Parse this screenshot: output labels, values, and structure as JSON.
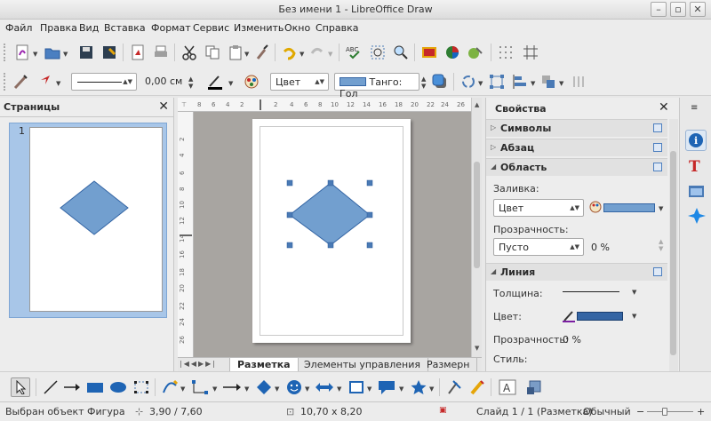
{
  "window": {
    "title": "Без имени 1 - LibreOffice Draw"
  },
  "menu": [
    "Файл",
    "Правка",
    "Вид",
    "Вставка",
    "Формат",
    "Сервис",
    "Изменить",
    "Окно",
    "Справка"
  ],
  "line_toolbar": {
    "width_value": "0,00 см",
    "fill_type": "Цвет",
    "fill_color_name": "Танго: Гол"
  },
  "pages_pane": {
    "title": "Страницы",
    "page_number": "1"
  },
  "tabs": [
    "Разметка",
    "Элементы управления",
    "Размерн"
  ],
  "sidebar": {
    "title": "Свойства",
    "sections": {
      "characters": "Символы",
      "paragraph": "Абзац",
      "area": "Область",
      "line": "Линия"
    },
    "area": {
      "fill_label": "Заливка:",
      "fill_value": "Цвет",
      "transparency_label": "Прозрачность:",
      "transparency_value": "Пусто",
      "transparency_percent": "0 %"
    },
    "line": {
      "width_label": "Толщина:",
      "color_label": "Цвет:",
      "transparency_label": "Прозрачность:",
      "transparency_value": "0 %",
      "style_label": "Стиль:"
    }
  },
  "status": {
    "selection": "Выбран объект Фигура",
    "position": "3,90 / 7,60",
    "size": "10,70 x 8,20",
    "page": "Слайд 1 / 1 (Разметка)",
    "style": "Обычный"
  },
  "colors": {
    "shape_fill": "#729fcf",
    "shape_stroke": "#3465a4",
    "handle": "#4a7ab5"
  }
}
